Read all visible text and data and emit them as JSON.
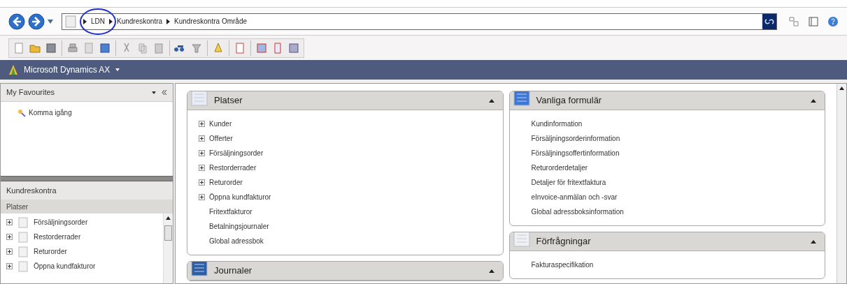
{
  "address_bar": {
    "crumbs": [
      {
        "label": "LDN",
        "highlighted": true
      },
      {
        "label": "Kundreskontra",
        "highlighted": false
      },
      {
        "label": "Kundreskontra Område",
        "highlighted": false
      }
    ]
  },
  "app_bar": {
    "title": "Microsoft Dynamics AX"
  },
  "favourites": {
    "title": "My Favourites",
    "items": [
      "Komma igång"
    ]
  },
  "module": {
    "title": "Kundreskontra",
    "section": "Platser",
    "tree": [
      {
        "label": "Försäljningsorder",
        "expanded": false
      },
      {
        "label": "Restorderrader",
        "expanded": false
      },
      {
        "label": "Returorder",
        "expanded": false
      },
      {
        "label": "Öppna kundfakturor",
        "expanded": false
      }
    ]
  },
  "columns": [
    [
      {
        "title": "Platser",
        "expanded": true,
        "items": [
          {
            "label": "Kunder",
            "kind": "group"
          },
          {
            "label": "Offerter",
            "kind": "group"
          },
          {
            "label": "Försäljningsorder",
            "kind": "group"
          },
          {
            "label": "Restorderrader",
            "kind": "group"
          },
          {
            "label": "Returorder",
            "kind": "group"
          },
          {
            "label": "Öppna kundfakturor",
            "kind": "group"
          },
          {
            "label": "Fritextfakturor",
            "kind": "link"
          },
          {
            "label": "Betalningsjournaler",
            "kind": "link"
          },
          {
            "label": "Global adressbok",
            "kind": "link"
          }
        ]
      },
      {
        "title": "Journaler",
        "expanded": true
      }
    ],
    [
      {
        "title": "Vanliga formulär",
        "expanded": true,
        "items": [
          {
            "label": "Kundinformation",
            "kind": "link"
          },
          {
            "label": "Försäljningsorderinformation",
            "kind": "link"
          },
          {
            "label": "Försäljningsoffertinformation",
            "kind": "link"
          },
          {
            "label": "Returorderdetaljer",
            "kind": "link"
          },
          {
            "label": "Detaljer för fritextfaktura",
            "kind": "link"
          },
          {
            "label": "eInvoice-anmälan och -svar",
            "kind": "link"
          },
          {
            "label": "Global adressboksinformation",
            "kind": "link"
          }
        ]
      },
      {
        "title": "Förfrågningar",
        "expanded": true,
        "items": [
          {
            "label": "Fakturaspecifikation",
            "kind": "link"
          }
        ]
      }
    ]
  ]
}
